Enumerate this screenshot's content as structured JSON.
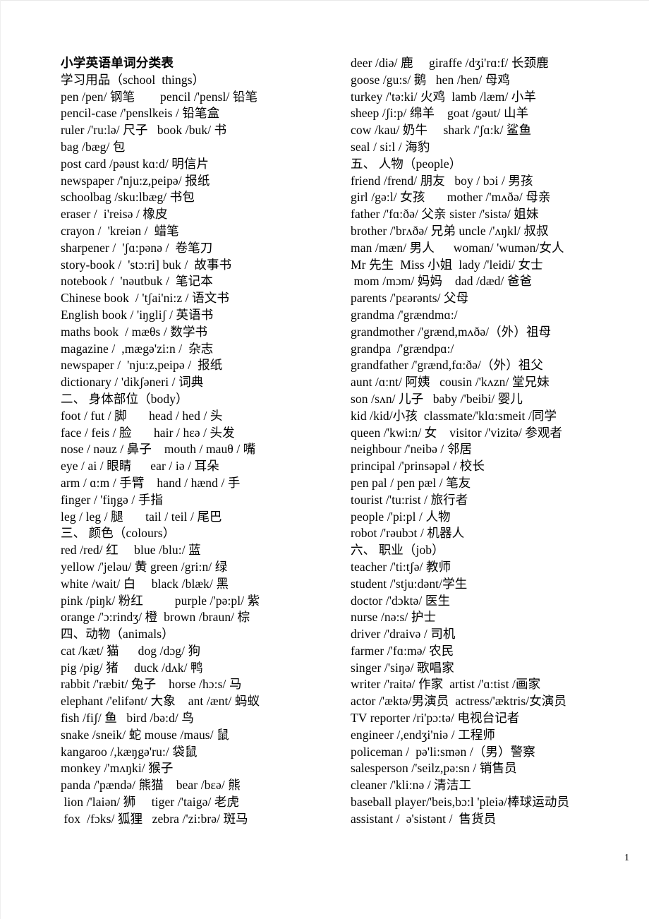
{
  "document": {
    "title": "小学英语单词分类表",
    "page_number": "1"
  },
  "left_column": {
    "lines": [
      "学习用品（school  things）",
      "pen /pen/ 钢笔        pencil /'pensl/ 铅笔",
      "pencil-case /'penslkeis / 铅笔盒",
      "ruler /'ru:lə/ 尺子   book /buk/ 书",
      "bag /bæg/ 包",
      "post card /pəust kɑ:d/ 明信片",
      "newspaper /'nju:z,peipə/ 报纸",
      "schoolbag /sku:lbæg/ 书包",
      "eraser /  i'reisə / 橡皮",
      "crayon /  'kreiən /  蜡笔",
      "sharpener /  'ʃɑ:pənə /  卷笔刀",
      "story-book /  'stɔ:ri] buk /  故事书",
      "notebook /  'nəutbuk /  笔记本",
      "Chinese book  / 'tʃai'ni:z / 语文书",
      "English book / 'iŋgliʃ / 英语书",
      "maths book  / mæθs / 数学书",
      "magazine /  ,mægə'zi:n /  杂志",
      "newspaper /  'nju:z,peipə /  报纸",
      "dictionary / 'dikʃəneri / 词典",
      "二、 身体部位（body）",
      "foot / fut / 脚       head / hed / 头",
      "face / feis / 脸       hair / hɛə / 头发",
      "nose / nəuz / 鼻子    mouth / mauθ / 嘴",
      "eye / ai / 眼睛      ear / iə / 耳朵",
      "arm / ɑ:m / 手臂    hand / hænd / 手",
      "finger / 'fiŋgə / 手指",
      "leg / leg / 腿       tail / teil / 尾巴",
      "三、 颜色（colours）",
      "red /red/ 红     blue /blu:/ 蓝",
      "yellow /'jeləu/ 黄 green /gri:n/ 绿",
      "white /wait/ 白     black /blæk/ 黑",
      "pink /piŋk/ 粉红          purple /'pə:pl/ 紫",
      "orange /'ɔ:rindʒ/ 橙  brown /braun/ 棕",
      "四、动物（animals）",
      "cat /kæt/ 猫      dog /dɔg/ 狗",
      "pig /pig/ 猪     duck /dʌk/ 鸭",
      "rabbit /'ræbit/ 兔子    horse /hɔ:s/ 马",
      "elephant /'elifənt/ 大象    ant /ænt/ 蚂蚁",
      "fish /fiʃ/ 鱼   bird /bə:d/ 鸟",
      "snake /sneik/ 蛇 mouse /maus/ 鼠",
      "kangaroo /,kæŋgə'ru:/ 袋鼠",
      "monkey /'mʌŋki/ 猴子",
      "panda /'pændə/ 熊猫    bear /bɛə/ 熊",
      " lion /'laiən/ 狮     tiger /'taigə/ 老虎",
      " fox  /fɔks/ 狐狸   zebra /'zi:brə/ 斑马"
    ]
  },
  "right_column": {
    "lines": [
      "deer /diə/ 鹿     giraffe /dʒi'rɑ:f/ 长颈鹿",
      "goose /gu:s/ 鹅   hen /hen/ 母鸡",
      "turkey /'tə:ki/ 火鸡  lamb /læm/ 小羊",
      "sheep /ʃi:p/ 绵羊    goat /gəut/ 山羊",
      "cow /kau/ 奶牛     shark /'ʃɑ:k/ 鲨鱼",
      "seal / si:l / 海豹",
      "五、 人物（people）",
      "friend /frend/ 朋友   boy / bɔi / 男孩",
      "girl /gə:l/ 女孩       mother /'mʌðə/ 母亲",
      "father /'fɑ:ðə/ 父亲 sister /'sistə/ 姐妹",
      "brother /'brʌðə/ 兄弟 uncle /'ʌŋkl/ 叔叔",
      "man /mæn/ 男人      woman/ 'wumən/女人",
      "Mr 先生  Miss 小姐  lady /'leidi/ 女士",
      " mom /mɔm/ 妈妈    dad /dæd/ 爸爸",
      "parents /'pɛərənts/ 父母",
      "grandma /'grændmɑ:/",
      "grandmother /'grænd,mʌðə/（外）祖母",
      "grandpa  /'grændpɑ:/",
      "grandfather /'grænd,fɑ:ðə/（外）祖父",
      "aunt /ɑ:nt/ 阿姨   cousin /'kʌzn/ 堂兄妹",
      "son /sʌn/ 儿子   baby /'beibi/ 婴儿",
      "kid /kid/小孩  classmate/'klɑ:smeit /同学",
      "queen /'kwi:n/ 女    visitor /'vizitə/ 参观者",
      "neighbour /'neibə / 邻居",
      "principal /'prinsəpəl / 校长",
      "pen pal / pen pæl / 笔友",
      "tourist /'tu:rist / 旅行者",
      "people /'pi:pl / 人物",
      "robot /'rəubɔt / 机器人",
      "六、 职业（job）",
      "teacher /'ti:tʃə/ 教师",
      "student /'stju:dənt/学生",
      "doctor /'dɔktə/ 医生",
      "nurse /nə:s/ 护士",
      "driver /'draivə / 司机",
      "farmer /'fɑ:mə/ 农民",
      "singer /'siŋə/ 歌唱家",
      "writer /'raitə/ 作家  artist /'ɑ:tist /画家",
      "actor /'æktə/男演员  actress/'æktris/女演员",
      "TV reporter /ri'pɔ:tə/ 电视台记者",
      "engineer /,endʒi'niə / 工程师",
      "policeman /  pə'li:smən /（男）警察",
      "salesperson /'seilz,pə:sn / 销售员",
      "cleaner /'kli:nə / 清洁工",
      "baseball player/'beis,bɔ:l 'pleiə/棒球运动员",
      "assistant /  ə'sistənt /  售货员"
    ]
  }
}
